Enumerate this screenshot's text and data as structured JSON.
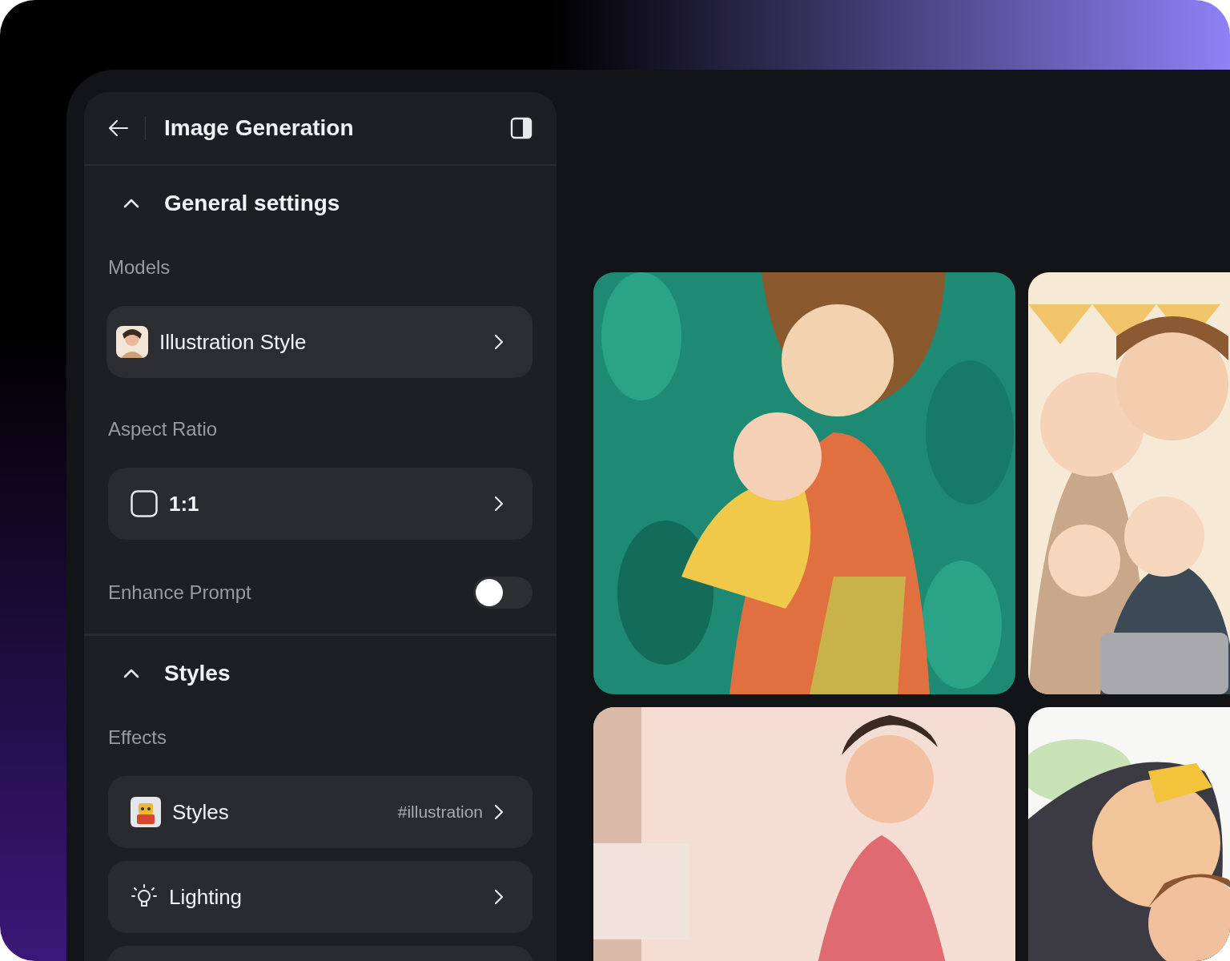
{
  "header": {
    "title": "Image Generation"
  },
  "sections": [
    {
      "title": "General settings",
      "expanded": true,
      "items": [
        {
          "kind": "label",
          "text": "Models"
        },
        {
          "kind": "model",
          "value": "Illustration Style"
        },
        {
          "kind": "label",
          "text": "Aspect Ratio"
        },
        {
          "kind": "ratio",
          "value": "1:1"
        },
        {
          "kind": "toggle",
          "text": "Enhance Prompt",
          "on": false
        }
      ]
    },
    {
      "title": "Styles",
      "expanded": true,
      "items": [
        {
          "kind": "label",
          "text": "Effects"
        },
        {
          "kind": "styles",
          "value": "Styles",
          "tag": "#illustration"
        },
        {
          "kind": "lighting",
          "value": "Lighting"
        }
      ]
    }
  ]
}
